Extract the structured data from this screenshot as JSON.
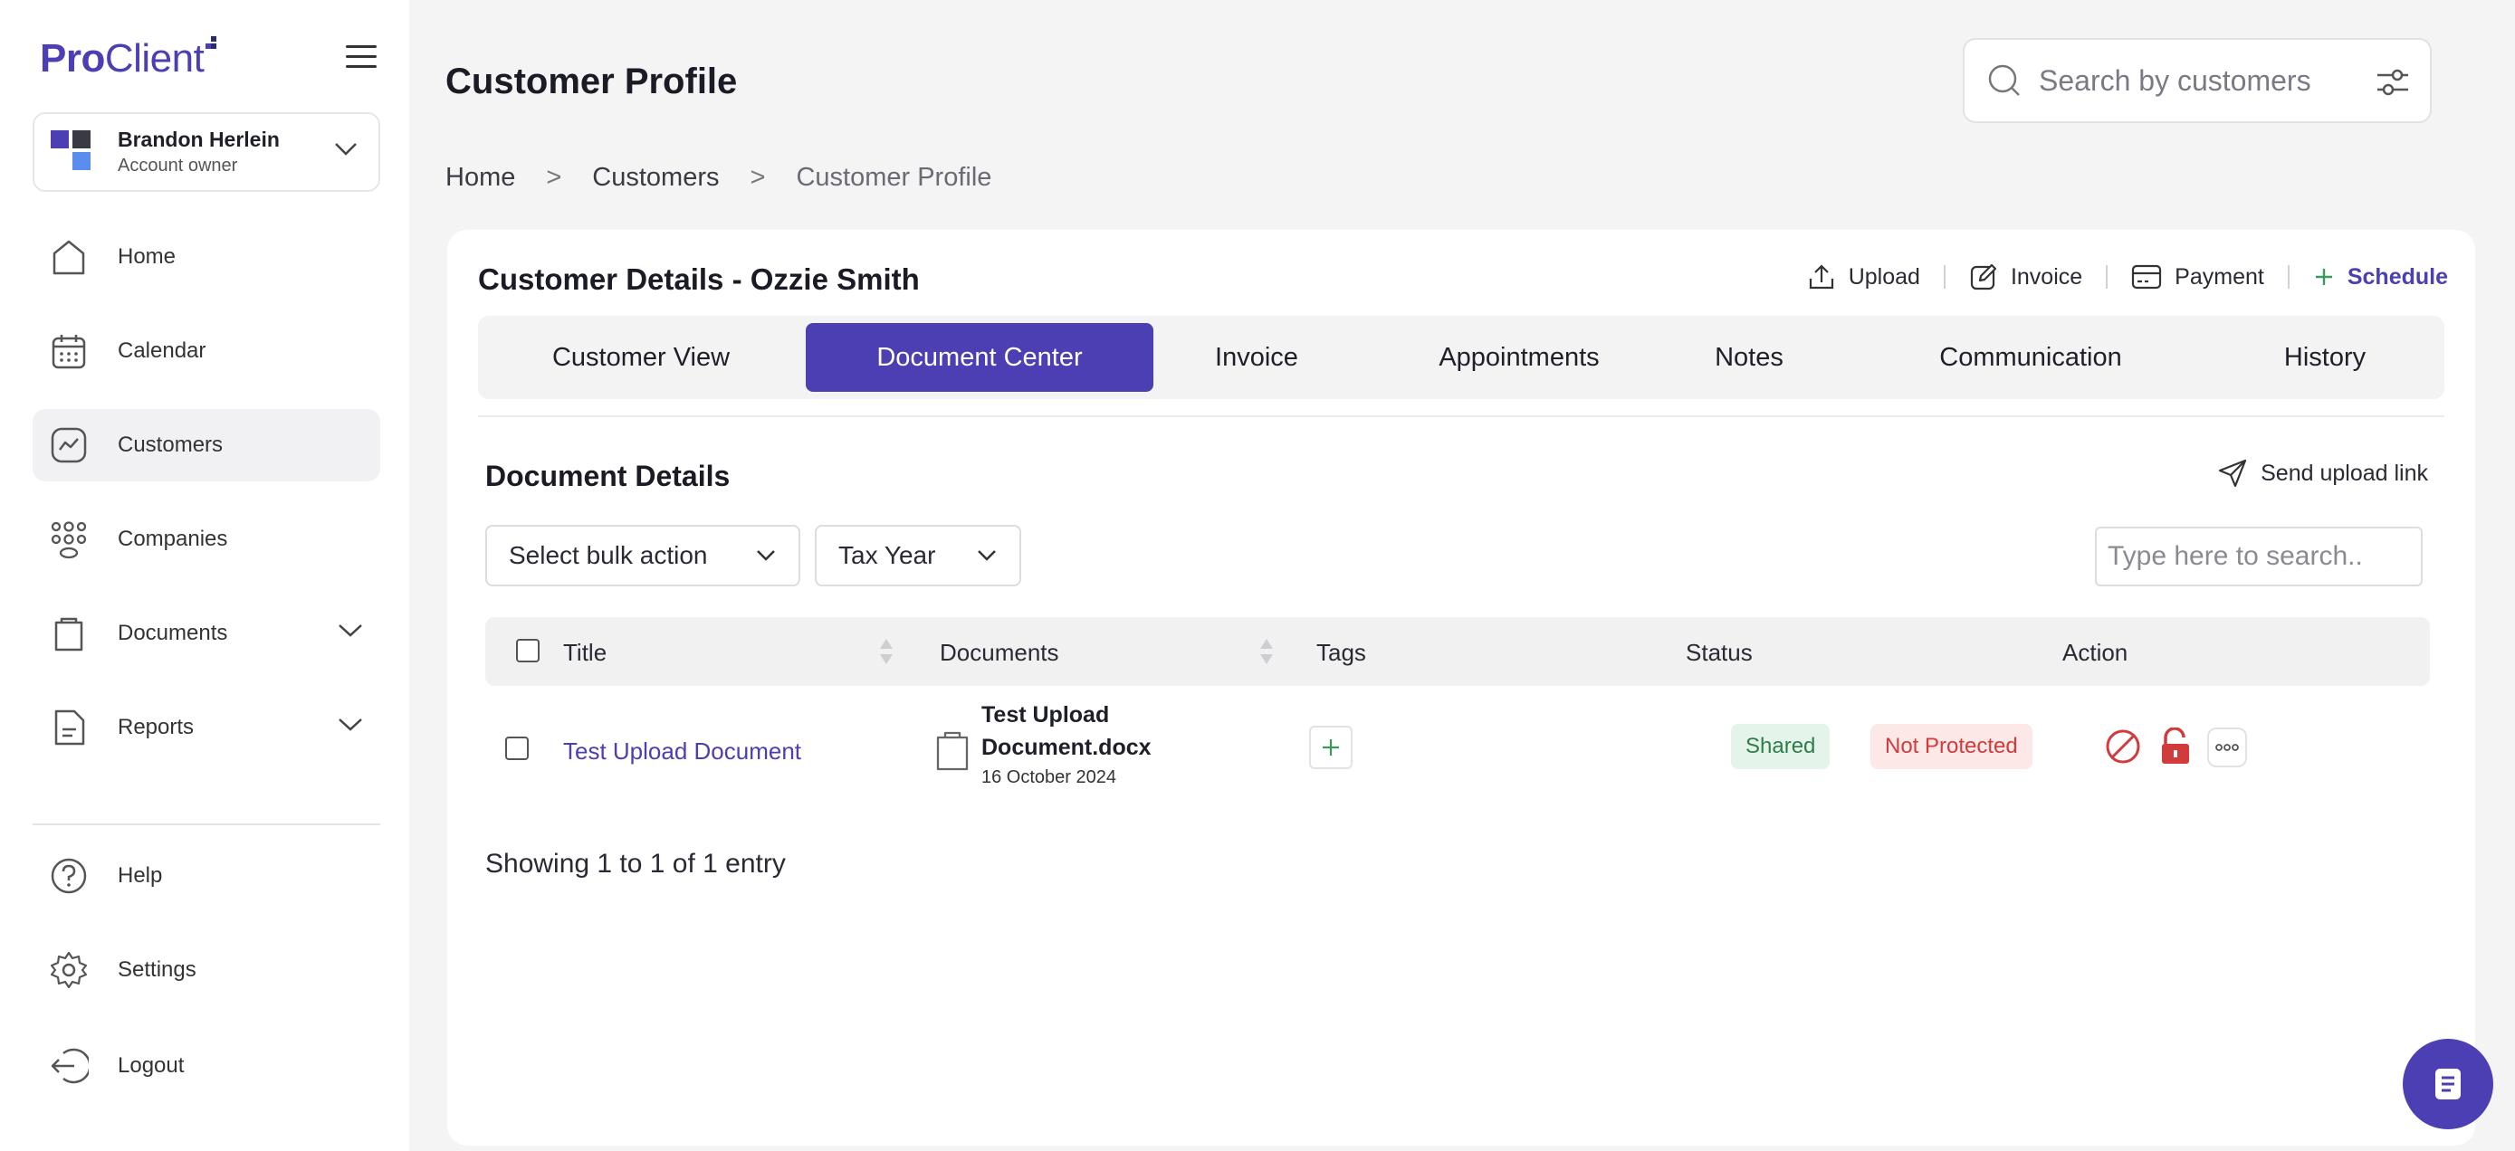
{
  "brand": {
    "pro": "Pro",
    "client": "Client"
  },
  "account": {
    "name": "Brandon Herlein",
    "role": "Account owner"
  },
  "sidebar": {
    "items": [
      {
        "label": "Home",
        "icon": "home-icon"
      },
      {
        "label": "Calendar",
        "icon": "calendar-icon"
      },
      {
        "label": "Customers",
        "icon": "chart-icon",
        "active": true
      },
      {
        "label": "Companies",
        "icon": "companies-icon"
      },
      {
        "label": "Documents",
        "icon": "clipboard-icon",
        "expandable": true
      },
      {
        "label": "Reports",
        "icon": "report-icon",
        "expandable": true
      }
    ],
    "bottom": [
      {
        "label": "Help",
        "icon": "help-icon"
      },
      {
        "label": "Settings",
        "icon": "gear-icon"
      },
      {
        "label": "Logout",
        "icon": "logout-icon"
      }
    ]
  },
  "header": {
    "title": "Customer Profile",
    "search_placeholder": "Search by customers"
  },
  "breadcrumb": [
    "Home",
    "Customers",
    "Customer Profile"
  ],
  "card": {
    "title": "Customer Details - Ozzie Smith",
    "actions": [
      "Upload",
      "Invoice",
      "Payment",
      "Schedule"
    ],
    "tabs": [
      "Customer View",
      "Document Center",
      "Invoice",
      "Appointments",
      "Notes",
      "Communication",
      "History"
    ],
    "active_tab": "Document Center"
  },
  "documents": {
    "section_title": "Document Details",
    "send_link": "Send upload link",
    "bulk_action": "Select bulk action",
    "tax_year": "Tax Year",
    "search_placeholder": "Type here to search..",
    "columns": [
      "Title",
      "Documents",
      "Tags",
      "Status",
      "Action"
    ],
    "rows": [
      {
        "title": "Test Upload Document",
        "file_name": "Test Upload Document.docx",
        "date": "16 October 2024",
        "status": [
          "Shared",
          "Not Protected"
        ]
      }
    ],
    "showing": "Showing 1 to 1 of 1 entry"
  },
  "colors": {
    "accent": "#4b3fb3",
    "shared_bg": "#e5f4ea",
    "shared_text": "#2f7d4a",
    "danger_bg": "#fde8e8",
    "danger_text": "#d23b3b"
  }
}
